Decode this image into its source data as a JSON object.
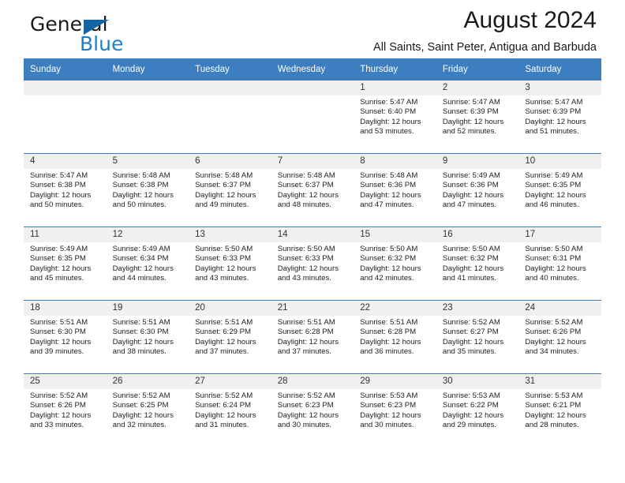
{
  "brand": {
    "name_part1": "General",
    "name_part2": "Blue",
    "logo_icon": "triangle-icon",
    "accent_color": "#1e7fc4"
  },
  "header": {
    "title": "August 2024",
    "subtitle": "All Saints, Saint Peter, Antigua and Barbuda"
  },
  "calendar": {
    "header_bg": "#3c7ebf",
    "daynum_bg": "#f0f0f0",
    "weekday_headers": [
      "Sunday",
      "Monday",
      "Tuesday",
      "Wednesday",
      "Thursday",
      "Friday",
      "Saturday"
    ],
    "weeks": [
      {
        "days": [
          {
            "num": "",
            "empty": true
          },
          {
            "num": "",
            "empty": true
          },
          {
            "num": "",
            "empty": true
          },
          {
            "num": "",
            "empty": true
          },
          {
            "num": "1",
            "sunrise": "Sunrise: 5:47 AM",
            "sunset": "Sunset: 6:40 PM",
            "daylight": "Daylight: 12 hours and 53 minutes."
          },
          {
            "num": "2",
            "sunrise": "Sunrise: 5:47 AM",
            "sunset": "Sunset: 6:39 PM",
            "daylight": "Daylight: 12 hours and 52 minutes."
          },
          {
            "num": "3",
            "sunrise": "Sunrise: 5:47 AM",
            "sunset": "Sunset: 6:39 PM",
            "daylight": "Daylight: 12 hours and 51 minutes."
          }
        ]
      },
      {
        "days": [
          {
            "num": "4",
            "sunrise": "Sunrise: 5:47 AM",
            "sunset": "Sunset: 6:38 PM",
            "daylight": "Daylight: 12 hours and 50 minutes."
          },
          {
            "num": "5",
            "sunrise": "Sunrise: 5:48 AM",
            "sunset": "Sunset: 6:38 PM",
            "daylight": "Daylight: 12 hours and 50 minutes."
          },
          {
            "num": "6",
            "sunrise": "Sunrise: 5:48 AM",
            "sunset": "Sunset: 6:37 PM",
            "daylight": "Daylight: 12 hours and 49 minutes."
          },
          {
            "num": "7",
            "sunrise": "Sunrise: 5:48 AM",
            "sunset": "Sunset: 6:37 PM",
            "daylight": "Daylight: 12 hours and 48 minutes."
          },
          {
            "num": "8",
            "sunrise": "Sunrise: 5:48 AM",
            "sunset": "Sunset: 6:36 PM",
            "daylight": "Daylight: 12 hours and 47 minutes."
          },
          {
            "num": "9",
            "sunrise": "Sunrise: 5:49 AM",
            "sunset": "Sunset: 6:36 PM",
            "daylight": "Daylight: 12 hours and 47 minutes."
          },
          {
            "num": "10",
            "sunrise": "Sunrise: 5:49 AM",
            "sunset": "Sunset: 6:35 PM",
            "daylight": "Daylight: 12 hours and 46 minutes."
          }
        ]
      },
      {
        "days": [
          {
            "num": "11",
            "sunrise": "Sunrise: 5:49 AM",
            "sunset": "Sunset: 6:35 PM",
            "daylight": "Daylight: 12 hours and 45 minutes."
          },
          {
            "num": "12",
            "sunrise": "Sunrise: 5:49 AM",
            "sunset": "Sunset: 6:34 PM",
            "daylight": "Daylight: 12 hours and 44 minutes."
          },
          {
            "num": "13",
            "sunrise": "Sunrise: 5:50 AM",
            "sunset": "Sunset: 6:33 PM",
            "daylight": "Daylight: 12 hours and 43 minutes."
          },
          {
            "num": "14",
            "sunrise": "Sunrise: 5:50 AM",
            "sunset": "Sunset: 6:33 PM",
            "daylight": "Daylight: 12 hours and 43 minutes."
          },
          {
            "num": "15",
            "sunrise": "Sunrise: 5:50 AM",
            "sunset": "Sunset: 6:32 PM",
            "daylight": "Daylight: 12 hours and 42 minutes."
          },
          {
            "num": "16",
            "sunrise": "Sunrise: 5:50 AM",
            "sunset": "Sunset: 6:32 PM",
            "daylight": "Daylight: 12 hours and 41 minutes."
          },
          {
            "num": "17",
            "sunrise": "Sunrise: 5:50 AM",
            "sunset": "Sunset: 6:31 PM",
            "daylight": "Daylight: 12 hours and 40 minutes."
          }
        ]
      },
      {
        "days": [
          {
            "num": "18",
            "sunrise": "Sunrise: 5:51 AM",
            "sunset": "Sunset: 6:30 PM",
            "daylight": "Daylight: 12 hours and 39 minutes."
          },
          {
            "num": "19",
            "sunrise": "Sunrise: 5:51 AM",
            "sunset": "Sunset: 6:30 PM",
            "daylight": "Daylight: 12 hours and 38 minutes."
          },
          {
            "num": "20",
            "sunrise": "Sunrise: 5:51 AM",
            "sunset": "Sunset: 6:29 PM",
            "daylight": "Daylight: 12 hours and 37 minutes."
          },
          {
            "num": "21",
            "sunrise": "Sunrise: 5:51 AM",
            "sunset": "Sunset: 6:28 PM",
            "daylight": "Daylight: 12 hours and 37 minutes."
          },
          {
            "num": "22",
            "sunrise": "Sunrise: 5:51 AM",
            "sunset": "Sunset: 6:28 PM",
            "daylight": "Daylight: 12 hours and 36 minutes."
          },
          {
            "num": "23",
            "sunrise": "Sunrise: 5:52 AM",
            "sunset": "Sunset: 6:27 PM",
            "daylight": "Daylight: 12 hours and 35 minutes."
          },
          {
            "num": "24",
            "sunrise": "Sunrise: 5:52 AM",
            "sunset": "Sunset: 6:26 PM",
            "daylight": "Daylight: 12 hours and 34 minutes."
          }
        ]
      },
      {
        "days": [
          {
            "num": "25",
            "sunrise": "Sunrise: 5:52 AM",
            "sunset": "Sunset: 6:26 PM",
            "daylight": "Daylight: 12 hours and 33 minutes."
          },
          {
            "num": "26",
            "sunrise": "Sunrise: 5:52 AM",
            "sunset": "Sunset: 6:25 PM",
            "daylight": "Daylight: 12 hours and 32 minutes."
          },
          {
            "num": "27",
            "sunrise": "Sunrise: 5:52 AM",
            "sunset": "Sunset: 6:24 PM",
            "daylight": "Daylight: 12 hours and 31 minutes."
          },
          {
            "num": "28",
            "sunrise": "Sunrise: 5:52 AM",
            "sunset": "Sunset: 6:23 PM",
            "daylight": "Daylight: 12 hours and 30 minutes."
          },
          {
            "num": "29",
            "sunrise": "Sunrise: 5:53 AM",
            "sunset": "Sunset: 6:23 PM",
            "daylight": "Daylight: 12 hours and 30 minutes."
          },
          {
            "num": "30",
            "sunrise": "Sunrise: 5:53 AM",
            "sunset": "Sunset: 6:22 PM",
            "daylight": "Daylight: 12 hours and 29 minutes."
          },
          {
            "num": "31",
            "sunrise": "Sunrise: 5:53 AM",
            "sunset": "Sunset: 6:21 PM",
            "daylight": "Daylight: 12 hours and 28 minutes."
          }
        ]
      }
    ]
  }
}
